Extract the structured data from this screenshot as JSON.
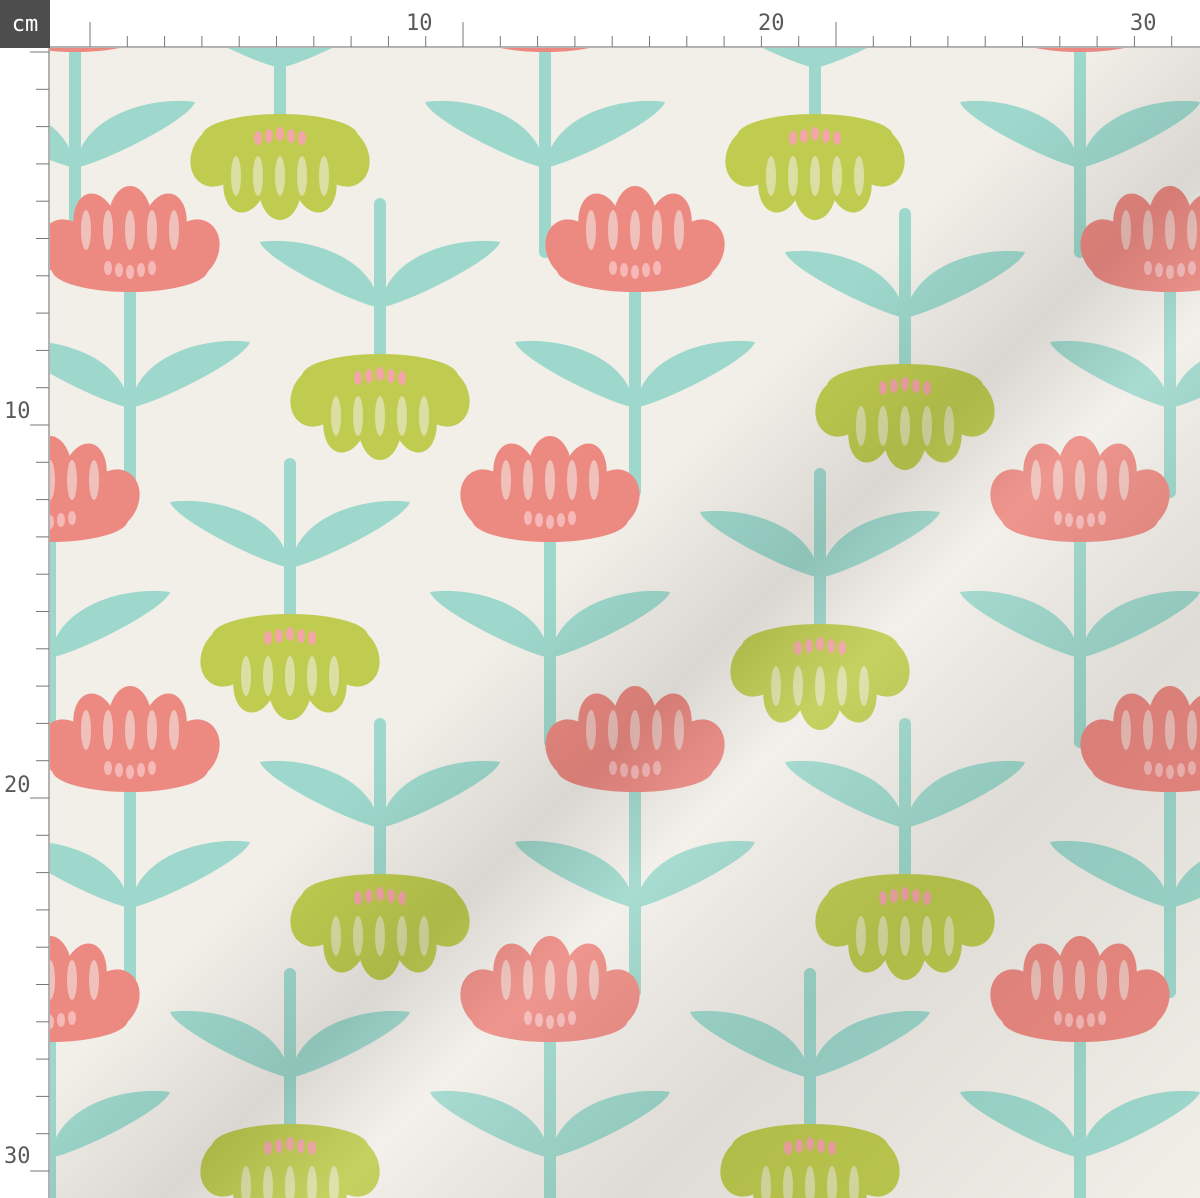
{
  "ruler": {
    "unit": "cm",
    "top_labels": [
      "10",
      "20",
      "30"
    ],
    "left_labels": [
      "10",
      "20",
      "30"
    ]
  },
  "fabric": {
    "pattern": "alternating pink and green flowers with aqua leaves",
    "colors": {
      "background": "#f2efe9",
      "pink_petal": "#ec8a82",
      "pink_center": "#f6b8b6",
      "green_petal": "#bfcc4f",
      "green_center": "#f3a6a6",
      "leaf": "#9ed8cc",
      "stem": "#9ed8cc"
    }
  }
}
